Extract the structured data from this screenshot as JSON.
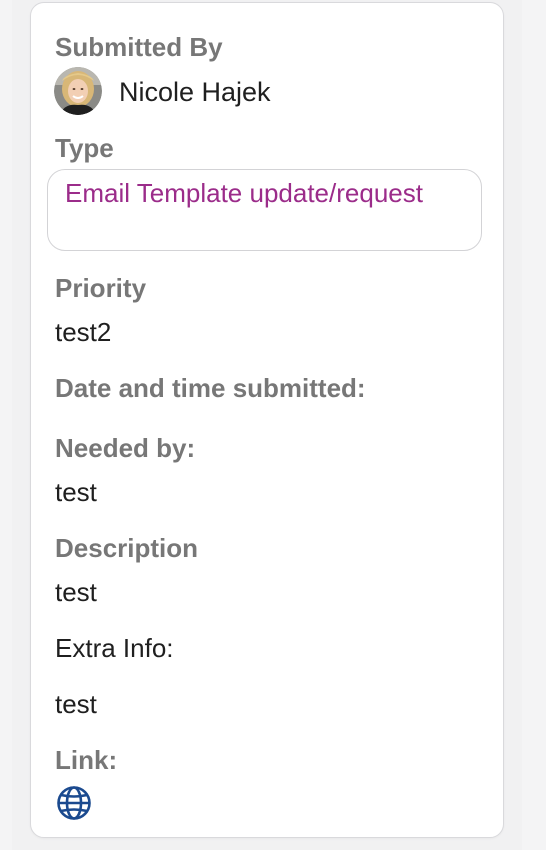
{
  "submitted_by": {
    "label": "Submitted By",
    "name": "Nicole Hajek"
  },
  "type": {
    "label": "Type",
    "value": "Email Template update/request",
    "color": "#9b2c8a"
  },
  "priority": {
    "label": "Priority",
    "value": "test2"
  },
  "date_submitted": {
    "label": "Date and time submitted:"
  },
  "needed_by": {
    "label": "Needed by:",
    "value": "test"
  },
  "description": {
    "label": "Description",
    "value": "test"
  },
  "extra_info": {
    "label": "Extra Info:",
    "value": "test"
  },
  "link": {
    "label": "Link:",
    "icon": "globe-icon",
    "icon_color": "#1b4a8f"
  }
}
